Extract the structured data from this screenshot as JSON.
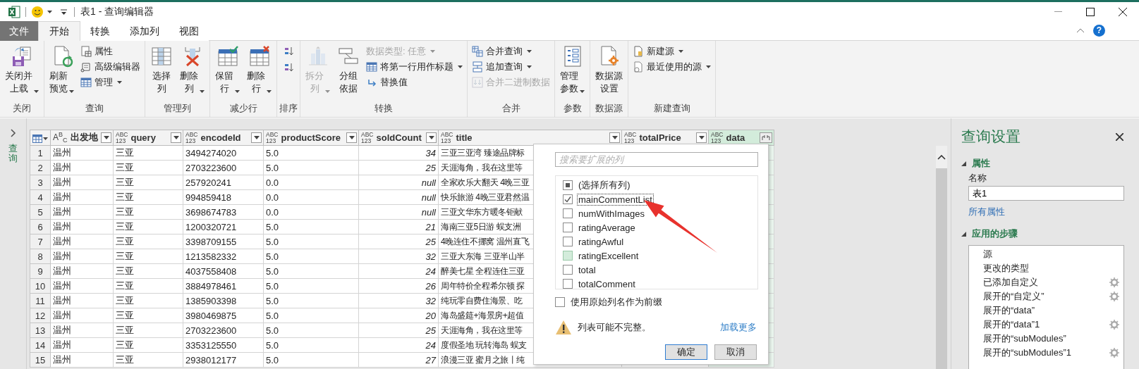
{
  "window": {
    "title": "表1 - 查询编辑器"
  },
  "menu_tabs": [
    {
      "label": "文件",
      "kind": "file",
      "selected": false
    },
    {
      "label": "开始",
      "kind": "tab",
      "selected": true
    },
    {
      "label": "转换",
      "kind": "tab",
      "selected": false
    },
    {
      "label": "添加列",
      "kind": "tab",
      "selected": false
    },
    {
      "label": "视图",
      "kind": "tab",
      "selected": false
    }
  ],
  "help_button": {
    "label": "?"
  },
  "ribbon": {
    "groups": [
      {
        "label": "关闭",
        "buttons": [
          {
            "label": "关闭并上载",
            "kind": "large",
            "dropdown": true,
            "disabled": false
          }
        ]
      },
      {
        "label": "查询",
        "buttons": [
          {
            "label": "刷新预览",
            "kind": "large",
            "dropdown": true,
            "disabled": false
          },
          {
            "label": "属性",
            "kind": "small",
            "dropdown": false,
            "disabled": false
          },
          {
            "label": "高级编辑器",
            "kind": "small",
            "dropdown": false,
            "disabled": false
          },
          {
            "label": "管理",
            "kind": "small",
            "dropdown": true,
            "disabled": false
          }
        ]
      },
      {
        "label": "管理列",
        "buttons": [
          {
            "label": "选择列",
            "kind": "large",
            "dropdown": false,
            "disabled": false
          },
          {
            "label": "删除列",
            "kind": "large",
            "dropdown": true,
            "disabled": false
          }
        ]
      },
      {
        "label": "减少行",
        "buttons": [
          {
            "label": "保留行",
            "kind": "large",
            "dropdown": true,
            "disabled": false
          },
          {
            "label": "删除行",
            "kind": "large",
            "dropdown": true,
            "disabled": false
          }
        ]
      },
      {
        "label": "排序",
        "buttons": [
          {
            "kind": "icon",
            "disabled": false
          },
          {
            "kind": "icon",
            "disabled": false
          }
        ]
      },
      {
        "label": "转换",
        "buttons": [
          {
            "label": "拆分列",
            "kind": "large",
            "dropdown": true,
            "disabled": true
          },
          {
            "label": "分组依据",
            "kind": "large",
            "dropdown": false,
            "disabled": false
          },
          {
            "label": "数据类型: 任意",
            "kind": "small",
            "dropdown": true,
            "disabled": true
          },
          {
            "label": "将第一行用作标题",
            "kind": "small",
            "dropdown": true,
            "disabled": false
          },
          {
            "label": "替换值",
            "kind": "small",
            "dropdown": false,
            "disabled": false
          }
        ]
      },
      {
        "label": "合并",
        "buttons": [
          {
            "label": "合并查询",
            "kind": "small",
            "dropdown": true,
            "disabled": false
          },
          {
            "label": "追加查询",
            "kind": "small",
            "dropdown": true,
            "disabled": false
          },
          {
            "label": "合并二进制数据",
            "kind": "small",
            "dropdown": false,
            "disabled": true
          }
        ]
      },
      {
        "label": "参数",
        "buttons": [
          {
            "label": "管理参数",
            "kind": "large",
            "dropdown": true,
            "disabled": false
          }
        ]
      },
      {
        "label": "数据源",
        "buttons": [
          {
            "label": "数据源设置",
            "kind": "large",
            "dropdown": false,
            "disabled": false
          }
        ]
      },
      {
        "label": "新建查询",
        "buttons": [
          {
            "label": "新建源",
            "kind": "small",
            "dropdown": true,
            "disabled": false
          },
          {
            "label": "最近使用的源",
            "kind": "small",
            "dropdown": true,
            "disabled": false
          }
        ]
      }
    ]
  },
  "queries_pane": {
    "label": "查询",
    "expanded": false
  },
  "table": {
    "columns": [
      {
        "name": "出发地",
        "kind": "text",
        "type_label": [
          "A",
          "B",
          "C"
        ],
        "selected": false
      },
      {
        "name": "query",
        "kind": "any",
        "type_label": [
          "ABC",
          "123"
        ],
        "selected": false
      },
      {
        "name": "encodeId",
        "kind": "any",
        "type_label": [
          "ABC",
          "123"
        ],
        "selected": false
      },
      {
        "name": "productScore",
        "kind": "any",
        "type_label": [
          "ABC",
          "123"
        ],
        "selected": false
      },
      {
        "name": "soldCount",
        "kind": "any",
        "type_label": [
          "ABC",
          "123"
        ],
        "selected": false
      },
      {
        "name": "title",
        "kind": "any",
        "type_label": [
          "ABC",
          "123"
        ],
        "selected": false
      },
      {
        "name": "totalPrice",
        "kind": "any",
        "type_label": [
          "ABC",
          "123"
        ],
        "selected": false
      },
      {
        "name": "data",
        "kind": "any",
        "type_label": [
          "ABC",
          "123"
        ],
        "selected": true
      }
    ],
    "rows": [
      {
        "number": "1",
        "cells": [
          "温州",
          "三亚",
          "3494274020",
          "5.0",
          {
            "value": "34",
            "numeric": true
          },
          "三亚三亚湾 臻途品牌标"
        ]
      },
      {
        "number": "2",
        "cells": [
          "温州",
          "三亚",
          "2703223600",
          "5.0",
          {
            "value": "25",
            "numeric": true
          },
          "天涯海角，我在这里等"
        ]
      },
      {
        "number": "3",
        "cells": [
          "温州",
          "三亚",
          "257920241",
          "0.0",
          {
            "value": "null",
            "numeric": true
          },
          "全家欢乐大翻天 4晚三亚"
        ]
      },
      {
        "number": "4",
        "cells": [
          "温州",
          "三亚",
          "994859418",
          "0.0",
          {
            "value": "null",
            "numeric": true
          },
          "快乐旅游 4晚三亚君然温"
        ]
      },
      {
        "number": "5",
        "cells": [
          "温州",
          "三亚",
          "3698674783",
          "0.0",
          {
            "value": "null",
            "numeric": true
          },
          "三亚文华东方暖冬钜献"
        ]
      },
      {
        "number": "6",
        "cells": [
          "温州",
          "三亚",
          "1200320721",
          "5.0",
          {
            "value": "21",
            "numeric": true
          },
          "海南三亚5日游 蜈支洲"
        ]
      },
      {
        "number": "7",
        "cells": [
          "温州",
          "三亚",
          "3398709155",
          "5.0",
          {
            "value": "25",
            "numeric": true
          },
          "4晚连住不挪窝 温州直飞"
        ]
      },
      {
        "number": "8",
        "cells": [
          "温州",
          "三亚",
          "1213582332",
          "5.0",
          {
            "value": "32",
            "numeric": true
          },
          "三亚大东海 三亚半山半"
        ]
      },
      {
        "number": "9",
        "cells": [
          "温州",
          "三亚",
          "4037558408",
          "5.0",
          {
            "value": "24",
            "numeric": true
          },
          "醉美七星 全程连住三亚"
        ]
      },
      {
        "number": "10",
        "cells": [
          "温州",
          "三亚",
          "3884978461",
          "5.0",
          {
            "value": "26",
            "numeric": true
          },
          "周年特价全程希尔顿 探"
        ]
      },
      {
        "number": "11",
        "cells": [
          "温州",
          "三亚",
          "1385903398",
          "5.0",
          {
            "value": "32",
            "numeric": true
          },
          "纯玩零自费住海景、吃"
        ]
      },
      {
        "number": "12",
        "cells": [
          "温州",
          "三亚",
          "3980469875",
          "5.0",
          {
            "value": "20",
            "numeric": true
          },
          "海岛盛筵+海景房+超值"
        ]
      },
      {
        "number": "13",
        "cells": [
          "温州",
          "三亚",
          "2703223600",
          "5.0",
          {
            "value": "25",
            "numeric": true
          },
          "天涯海角，我在这里等"
        ]
      },
      {
        "number": "14",
        "cells": [
          "温州",
          "三亚",
          "3353125550",
          "5.0",
          {
            "value": "24",
            "numeric": true
          },
          "度假圣地 玩转海岛 蜈支"
        ]
      },
      {
        "number": "15",
        "cells": [
          "温州",
          "三亚",
          "2938012177",
          "5.0",
          {
            "value": "27",
            "numeric": true
          },
          "浪漫三亚 蜜月之旅丨纯"
        ]
      }
    ]
  },
  "expand_dialog": {
    "search": {
      "placeholder": "搜索要扩展的列"
    },
    "columns": [
      {
        "label": "(选择所有列)",
        "checked": false,
        "indeterminate": true,
        "focused": false,
        "hovered": false
      },
      {
        "label": "mainCommentList",
        "checked": true,
        "indeterminate": false,
        "focused": true,
        "hovered": false
      },
      {
        "label": "numWithImages",
        "checked": false,
        "indeterminate": false,
        "focused": false,
        "hovered": false
      },
      {
        "label": "ratingAverage",
        "checked": false,
        "indeterminate": false,
        "focused": false,
        "hovered": false
      },
      {
        "label": "ratingAwful",
        "checked": false,
        "indeterminate": false,
        "focused": false,
        "hovered": false
      },
      {
        "label": "ratingExcellent",
        "checked": false,
        "indeterminate": false,
        "focused": false,
        "hovered": true
      },
      {
        "label": "total",
        "checked": false,
        "indeterminate": false,
        "focused": false,
        "hovered": false
      },
      {
        "label": "totalComment",
        "checked": false,
        "indeterminate": false,
        "focused": false,
        "hovered": false
      }
    ],
    "prefix_option": {
      "label": "使用原始列名作为前缀",
      "checked": false
    },
    "warning": "列表可能不完整。",
    "load_more": "加载更多",
    "buttons": [
      {
        "label": "确定",
        "default": true
      },
      {
        "label": "取消",
        "default": false
      }
    ]
  },
  "query_settings": {
    "title": "查询设置",
    "properties": {
      "heading": "属性",
      "expanded": true,
      "name_label": "名称",
      "name_value": "表1",
      "all_properties": "所有属性"
    },
    "steps": {
      "heading": "应用的步骤",
      "expanded": true,
      "items": [
        {
          "label": "源",
          "settings": false
        },
        {
          "label": "更改的类型",
          "settings": false
        },
        {
          "label": "已添加自定义",
          "settings": true
        },
        {
          "label": "展开的“自定义”",
          "settings": true
        },
        {
          "label": "展开的“data”",
          "settings": false
        },
        {
          "label": "展开的“data”1",
          "settings": true
        },
        {
          "label": "展开的“subModules”",
          "settings": false
        },
        {
          "label": "展开的“subModules”1",
          "settings": true
        }
      ]
    }
  }
}
